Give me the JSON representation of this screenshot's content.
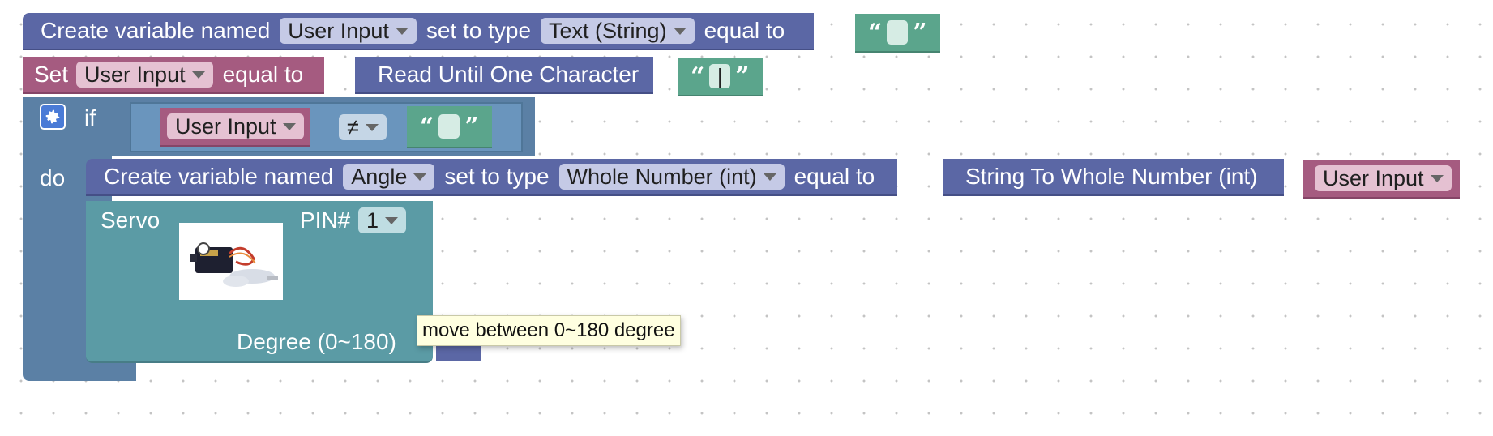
{
  "blocks": {
    "create_text": {
      "prefix": "Create variable named",
      "var_name": "User Input",
      "mid": "set to type",
      "type": "Text (String)",
      "suffix": "equal to",
      "value": ""
    },
    "set_input": {
      "prefix": "Set",
      "var_name": "User Input",
      "suffix": "equal to",
      "read_label": "Read Until One Character",
      "char_value": "|"
    },
    "if_block": {
      "if_label": "if",
      "do_label": "do",
      "left_var": "User Input",
      "operator": "≠",
      "right_value": ""
    },
    "create_angle": {
      "prefix": "Create variable named",
      "var_name": "Angle",
      "mid": "set to type",
      "type": "Whole Number (int)",
      "suffix": "equal to",
      "convert_label": "String To Whole Number (int)",
      "source_var": "User Input"
    },
    "servo": {
      "label": "Servo",
      "pin_label": "PIN#",
      "pin_value": "1",
      "image_alt": "servo motor",
      "degree_label": "Degree (0~180)",
      "tooltip": "move between 0~180 degree"
    }
  },
  "colors": {
    "variables": "#5b67a5",
    "set": "#a55b80",
    "text": "#5ba58c",
    "control": "#5b80a5",
    "servo": "#5b9ba5",
    "tooltip_bg": "#ffffe0"
  },
  "icons": {
    "mutator": "gear-icon",
    "dropdown": "caret-down-icon",
    "open_quote": "open-quote-icon",
    "close_quote": "close-quote-icon"
  }
}
